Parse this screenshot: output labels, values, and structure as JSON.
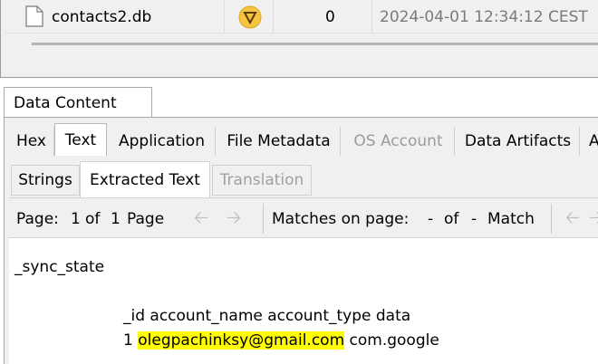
{
  "file_table": {
    "filename": "contacts2.db",
    "count": "0",
    "timestamp": "2024-04-01 12:34:12 CEST",
    "icons": {
      "file": "file-icon",
      "status": "warning-triangle-icon"
    }
  },
  "panel": {
    "title": "Data Content"
  },
  "viewer_tabs": [
    {
      "label": "Hex",
      "state": "normal"
    },
    {
      "label": "Text",
      "state": "active"
    },
    {
      "label": "Application",
      "state": "normal"
    },
    {
      "label": "File Metadata",
      "state": "normal"
    },
    {
      "label": "OS Account",
      "state": "disabled"
    },
    {
      "label": "Data Artifacts",
      "state": "normal"
    },
    {
      "label": "A",
      "state": "normal"
    }
  ],
  "sub_tabs": [
    {
      "label": "Strings",
      "state": "normal"
    },
    {
      "label": "Extracted Text",
      "state": "active"
    },
    {
      "label": "Translation",
      "state": "disabled"
    }
  ],
  "toolbar": {
    "page_label": "Page:",
    "page_current": "1",
    "page_of": "of",
    "page_total": "1",
    "page_word": "Page",
    "matches_label": "Matches on page:",
    "match_current": "-",
    "match_of": "of",
    "match_total": "-",
    "match_word": "Match"
  },
  "content": {
    "line1": "_sync_state",
    "line2": "_id account_name account_type data",
    "line3_prefix": "1 ",
    "line3_highlight": "olegpachinksy@gmail.com",
    "line3_suffix": " com.google"
  },
  "colors": {
    "highlight": "#ffff00",
    "status_icon": "#f5c542"
  }
}
